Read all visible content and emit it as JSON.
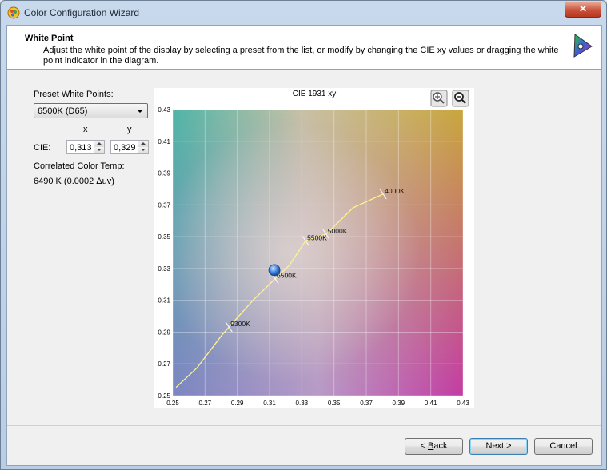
{
  "window": {
    "title": "Color Configuration Wizard",
    "close_label": "✕"
  },
  "header": {
    "title": "White Point",
    "description": "Adjust the white point of the display by selecting a preset from the list, or modify by changing the CIE xy values or dragging the white point indicator in the diagram."
  },
  "preset": {
    "label": "Preset White Points:",
    "selected": "6500K (D65)"
  },
  "cie": {
    "label": "CIE:",
    "x_header": "x",
    "y_header": "y",
    "x_value": "0,313",
    "y_value": "0,329"
  },
  "cct": {
    "label": "Correlated Color Temp:",
    "value": "6490 K (0.0002 Δuv)"
  },
  "diagram": {
    "title": "CIE 1931 xy",
    "zoom_in_icon": "zoom-in-icon",
    "zoom_out_icon": "zoom-out-icon",
    "x_ticks": [
      "0.25",
      "0.27",
      "0.29",
      "0.31",
      "0.33",
      "0.35",
      "0.37",
      "0.39",
      "0.41",
      "0.43"
    ],
    "y_ticks": [
      "0.43",
      "0.41",
      "0.39",
      "0.37",
      "0.35",
      "0.33",
      "0.31",
      "0.29",
      "0.27",
      "0.25"
    ],
    "x_range": [
      0.25,
      0.43
    ],
    "y_range": [
      0.25,
      0.43
    ],
    "planckian_locus": [
      [
        0.252,
        0.2552
      ],
      [
        0.265,
        0.2675
      ],
      [
        0.2806,
        0.2883
      ],
      [
        0.3,
        0.3103
      ],
      [
        0.3135,
        0.3236
      ],
      [
        0.3222,
        0.3319
      ],
      [
        0.3324,
        0.3474
      ],
      [
        0.3451,
        0.3516
      ],
      [
        0.3618,
        0.3682
      ],
      [
        0.3805,
        0.3768
      ]
    ],
    "cct_marks": [
      {
        "label": "9300K",
        "x": 0.2848,
        "y": 0.2932
      },
      {
        "label": "6500K",
        "x": 0.3135,
        "y": 0.3236
      },
      {
        "label": "5500K",
        "x": 0.3324,
        "y": 0.3474
      },
      {
        "label": "5000K",
        "x": 0.3451,
        "y": 0.3516
      },
      {
        "label": "4000K",
        "x": 0.3805,
        "y": 0.3768
      }
    ],
    "white_point": {
      "x": 0.313,
      "y": 0.329
    },
    "locus_color": "#fff48a"
  },
  "buttons": {
    "back_prefix": "< ",
    "back_key": "B",
    "back_rest": "ack",
    "next": "Next >",
    "cancel": "Cancel"
  }
}
